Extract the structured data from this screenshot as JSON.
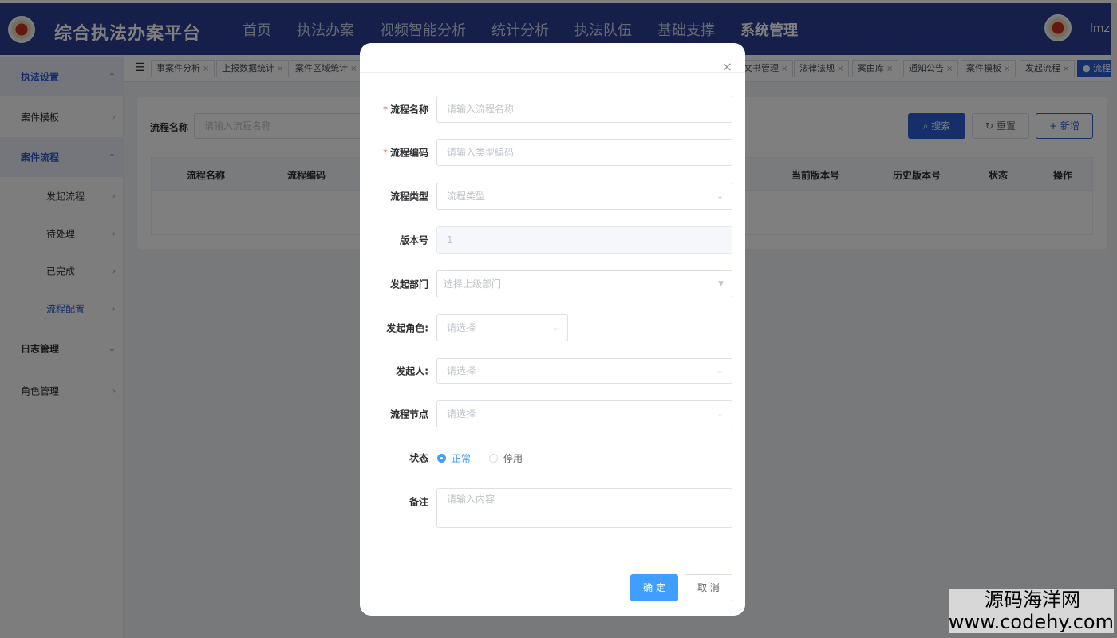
{
  "header": {
    "title": "综合执法办案平台",
    "nav": [
      "首页",
      "执法办案",
      "视频智能分析",
      "统计分析",
      "执法队伍",
      "基础支撑",
      "系统管理"
    ],
    "active_nav": "系统管理",
    "user": "lmz"
  },
  "sidebar": {
    "items": [
      {
        "label": "执法设置",
        "arrow": "⌃"
      },
      {
        "label": "案件模板",
        "arrow": "›"
      },
      {
        "label": "案件流程",
        "arrow": "⌃"
      },
      {
        "label": "发起流程",
        "arrow": "›"
      },
      {
        "label": "待处理",
        "arrow": "›"
      },
      {
        "label": "已完成",
        "arrow": "›"
      },
      {
        "label": "流程配置",
        "arrow": "›"
      },
      {
        "label": "日志管理",
        "arrow": "⌄"
      },
      {
        "label": "角色管理",
        "arrow": "›"
      }
    ]
  },
  "tabs": [
    "事案件分析",
    "上报数据统计",
    "案件区域统计",
    "文书管理",
    "法律法规",
    "案由库",
    "通知公告",
    "案件模板",
    "发起流程",
    "● 流程"
  ],
  "search": {
    "label": "流程名称",
    "placeholder": "请输入流程名称",
    "search_btn": "搜索",
    "reset_btn": "重置",
    "add_btn": "+ 新增"
  },
  "table": {
    "columns": [
      "流程名称",
      "流程编码",
      "当前版本号",
      "历史版本号",
      "状态",
      "操作"
    ]
  },
  "dialog": {
    "close": "×",
    "fields": {
      "name": {
        "label": "流程名称",
        "required": "*",
        "placeholder": "请输入流程名称"
      },
      "code": {
        "label": "流程编码",
        "required": "*",
        "placeholder": "请输入类型编码"
      },
      "type": {
        "label": "流程类型",
        "placeholder": "流程类型"
      },
      "version": {
        "label": "版本号",
        "value": "1"
      },
      "dept": {
        "label": "发起部门",
        "placeholder": "选择上级部门"
      },
      "role": {
        "label": "发起角色:",
        "placeholder": "请选择"
      },
      "starter": {
        "label": "发起人:",
        "placeholder": "请选择"
      },
      "nodes": {
        "label": "流程节点",
        "placeholder": "请选择"
      },
      "status": {
        "label": "状态",
        "options": [
          "正常",
          "停用"
        ],
        "selected": "正常"
      },
      "remark": {
        "label": "备注",
        "placeholder": "请输入内容"
      }
    },
    "confirm": "确 定",
    "cancel": "取 消"
  },
  "watermark": {
    "line1": "源码海洋网",
    "line2": "www.codehy.com"
  },
  "colors": {
    "header": "#2c3f95",
    "primary": "#409eff",
    "active_tab": "#2c5fd4",
    "required": "#f56c6c"
  }
}
